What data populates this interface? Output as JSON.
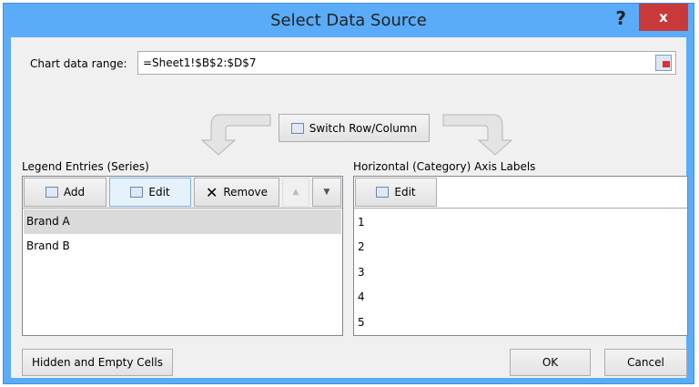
{
  "window": {
    "title": "Select Data Source",
    "help": "?",
    "close": "x"
  },
  "range": {
    "label": "Chart data range:",
    "value": "=Sheet1!$B$2:$D$7"
  },
  "switch_label": "Switch Row/Column",
  "legend": {
    "label": "Legend Entries (Series)",
    "add": "Add",
    "edit": "Edit",
    "remove": "Remove",
    "up": "▲",
    "down": "▼",
    "items": [
      "Brand A",
      "Brand B"
    ],
    "selected": "Brand A"
  },
  "axis": {
    "label": "Horizontal (Category) Axis Labels",
    "edit": "Edit",
    "items": [
      "1",
      "2",
      "3",
      "4",
      "5"
    ]
  },
  "footer": {
    "hidden": "Hidden and Empty Cells",
    "ok": "OK",
    "cancel": "Cancel"
  }
}
